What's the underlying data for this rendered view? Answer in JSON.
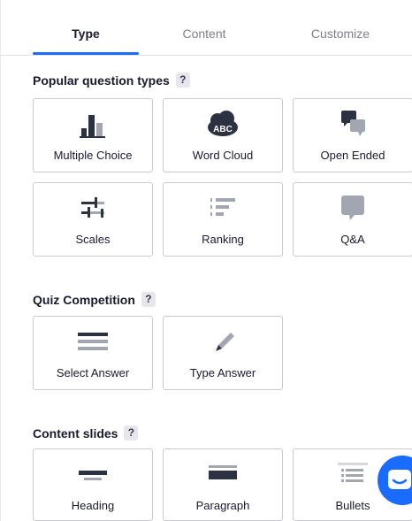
{
  "tabs": [
    {
      "label": "Type",
      "active": true
    },
    {
      "label": "Content",
      "active": false
    },
    {
      "label": "Customize",
      "active": false
    }
  ],
  "sections": {
    "popular": {
      "title": "Popular question types",
      "help": "?",
      "cards": [
        {
          "label": "Multiple Choice",
          "icon": "bar-chart-icon"
        },
        {
          "label": "Word Cloud",
          "icon": "word-cloud-icon"
        },
        {
          "label": "Open Ended",
          "icon": "speech-bubbles-icon"
        },
        {
          "label": "Scales",
          "icon": "scales-icon"
        },
        {
          "label": "Ranking",
          "icon": "ranking-icon"
        },
        {
          "label": "Q&A",
          "icon": "qa-bubble-icon"
        }
      ]
    },
    "quiz": {
      "title": "Quiz Competition",
      "help": "?",
      "cards": [
        {
          "label": "Select Answer",
          "icon": "list-lines-icon"
        },
        {
          "label": "Type Answer",
          "icon": "pencil-icon"
        }
      ]
    },
    "content": {
      "title": "Content slides",
      "help": "?",
      "cards": [
        {
          "label": "Heading",
          "icon": "heading-icon"
        },
        {
          "label": "Paragraph",
          "icon": "paragraph-icon"
        },
        {
          "label": "Bullets",
          "icon": "bullets-icon"
        }
      ]
    }
  },
  "word_cloud_icon_text": "ABC",
  "colors": {
    "accent": "#196cff",
    "icon_dark": "#2d3242",
    "icon_gray": "#a2a6b0",
    "border": "#c9c9d2"
  }
}
